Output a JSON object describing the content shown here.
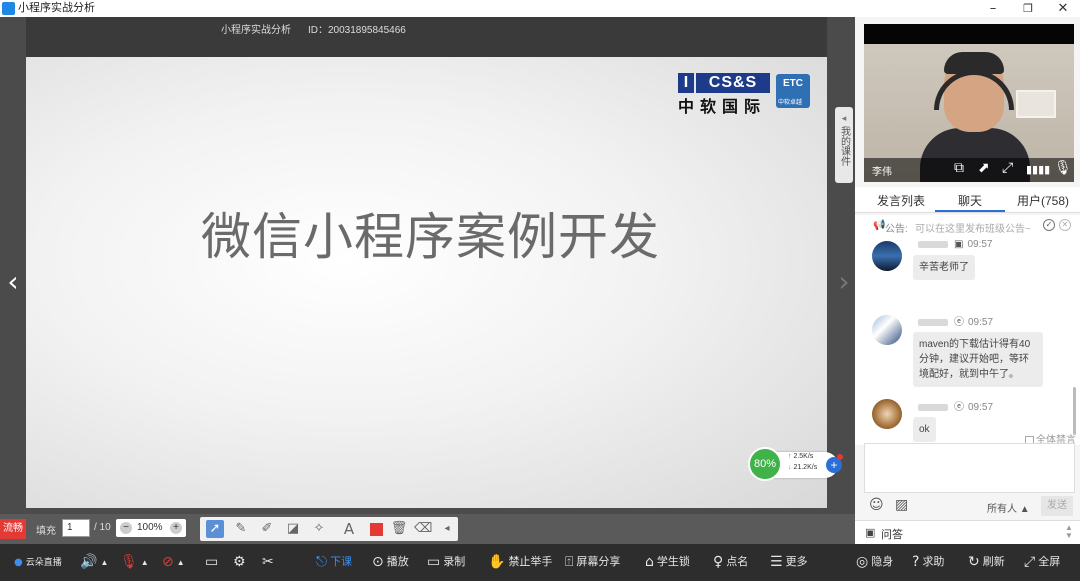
{
  "window": {
    "title": "小程序实战分析",
    "minimize": "–",
    "restore": "❐",
    "close": "✕"
  },
  "stage": {
    "course_name": "小程序实战分析",
    "room_id": "ID：20031895845466",
    "slide_title": "微信小程序案例开发",
    "logo": {
      "i": "I",
      "css": "CS&S",
      "etc": "ETC",
      "cn": "中软国际",
      "sub": "中软卓越"
    },
    "courseware_tab": "我的课件",
    "network": {
      "percent": "80%",
      "up": "2.5K/s",
      "down": "21.2K/s"
    }
  },
  "toolbar": {
    "smooth": "流畅",
    "fill_label": "填充",
    "page_current": "1",
    "page_total": "/ 10",
    "zoom": "100%",
    "tools": [
      "select-pointer",
      "pen",
      "highlighter",
      "shape",
      "laser-pointer",
      "text",
      "color",
      "delete",
      "eraser"
    ]
  },
  "controlbar": {
    "brand": "云朵直播",
    "dismiss_class": "下课",
    "playback": "播放",
    "record": "录制",
    "ban_raise_hand": "禁止举手",
    "screen_share": "屏幕分享",
    "student_lock": "学生锁",
    "roll_call": "点名",
    "more": "更多",
    "stealth": "隐身",
    "help": "求助",
    "refresh": "刷新",
    "fullscreen": "全屏"
  },
  "panel": {
    "teacher_name": "李伟",
    "tabs": [
      "发言列表",
      "聊天",
      "用户(758)"
    ],
    "active_tab": "聊天",
    "notice_label": "公告:",
    "notice_placeholder": "可以在这里发布班级公告~",
    "messages": [
      {
        "time": "09:57",
        "text": "辛苦老师了"
      },
      {
        "time": "09:57",
        "text": "maven的下载估计得有40分钟，建议开始吧，等环境配好，就到中午了。"
      },
      {
        "time": "09:57",
        "text": "ok"
      }
    ],
    "mute_all": "全体禁言",
    "recipient": "所有人",
    "send": "发送",
    "qa": "问答"
  },
  "colors": {
    "accent_blue": "#2b6fd6",
    "alert_red": "#e53935",
    "network_green": "#3fb24a"
  }
}
